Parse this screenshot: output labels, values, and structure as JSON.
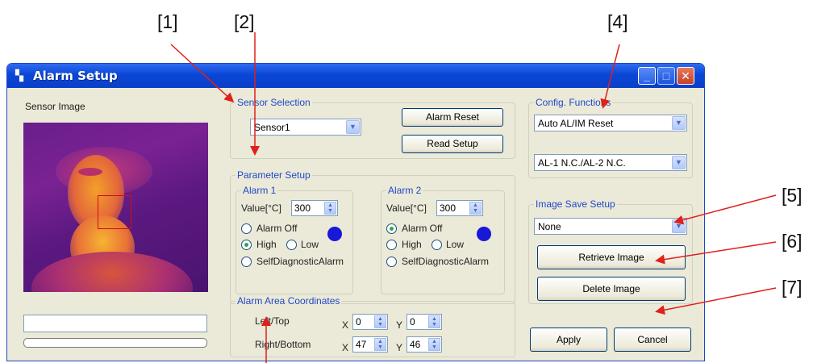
{
  "callouts": [
    "[1]",
    "[2]",
    "[4]",
    "[5]",
    "[6]",
    "[7]"
  ],
  "window": {
    "title": "Alarm Setup",
    "minimize_glyph": "_",
    "maximize_glyph": "□",
    "close_glyph": "✕"
  },
  "sensor_image": {
    "label": "Sensor Image"
  },
  "sensor_selection": {
    "title": "Sensor Selection",
    "selected": "Sensor1",
    "alarm_reset_label": "Alarm Reset",
    "read_setup_label": "Read Setup"
  },
  "parameter_setup": {
    "title": "Parameter Setup",
    "alarms": [
      {
        "title": "Alarm 1",
        "value_label": "Value[°C]",
        "value": "300",
        "alarm_off": "Alarm Off",
        "high": "High",
        "low": "Low",
        "self_diag": "SelfDiagnosticAlarm",
        "selected": "High"
      },
      {
        "title": "Alarm 2",
        "value_label": "Value[°C]",
        "value": "300",
        "alarm_off": "Alarm Off",
        "high": "High",
        "low": "Low",
        "self_diag": "SelfDiagnosticAlarm",
        "selected": "Alarm Off"
      }
    ]
  },
  "alarm_area": {
    "title": "Alarm Area Coordinates",
    "left_top_label": "Left/Top",
    "right_bottom_label": "Right/Bottom",
    "x_label": "X",
    "y_label": "Y",
    "left": "0",
    "top": "0",
    "right": "47",
    "bottom": "46"
  },
  "config_functions": {
    "title": "Config. Functions",
    "reset_mode": "Auto AL/IM Reset",
    "contact_mode": "AL-1 N.C./AL-2 N.C."
  },
  "image_save_setup": {
    "title": "Image Save Setup",
    "selected": "None",
    "retrieve_label": "Retrieve Image",
    "delete_label": "Delete Image"
  },
  "footer": {
    "apply_label": "Apply",
    "cancel_label": "Cancel"
  },
  "colors": {
    "title_bar": "#0a47d6",
    "group_title": "#1f49c8",
    "dialog_bg": "#ebe9d8",
    "callout_arrow": "#e0201a",
    "led": "#1818d8"
  }
}
